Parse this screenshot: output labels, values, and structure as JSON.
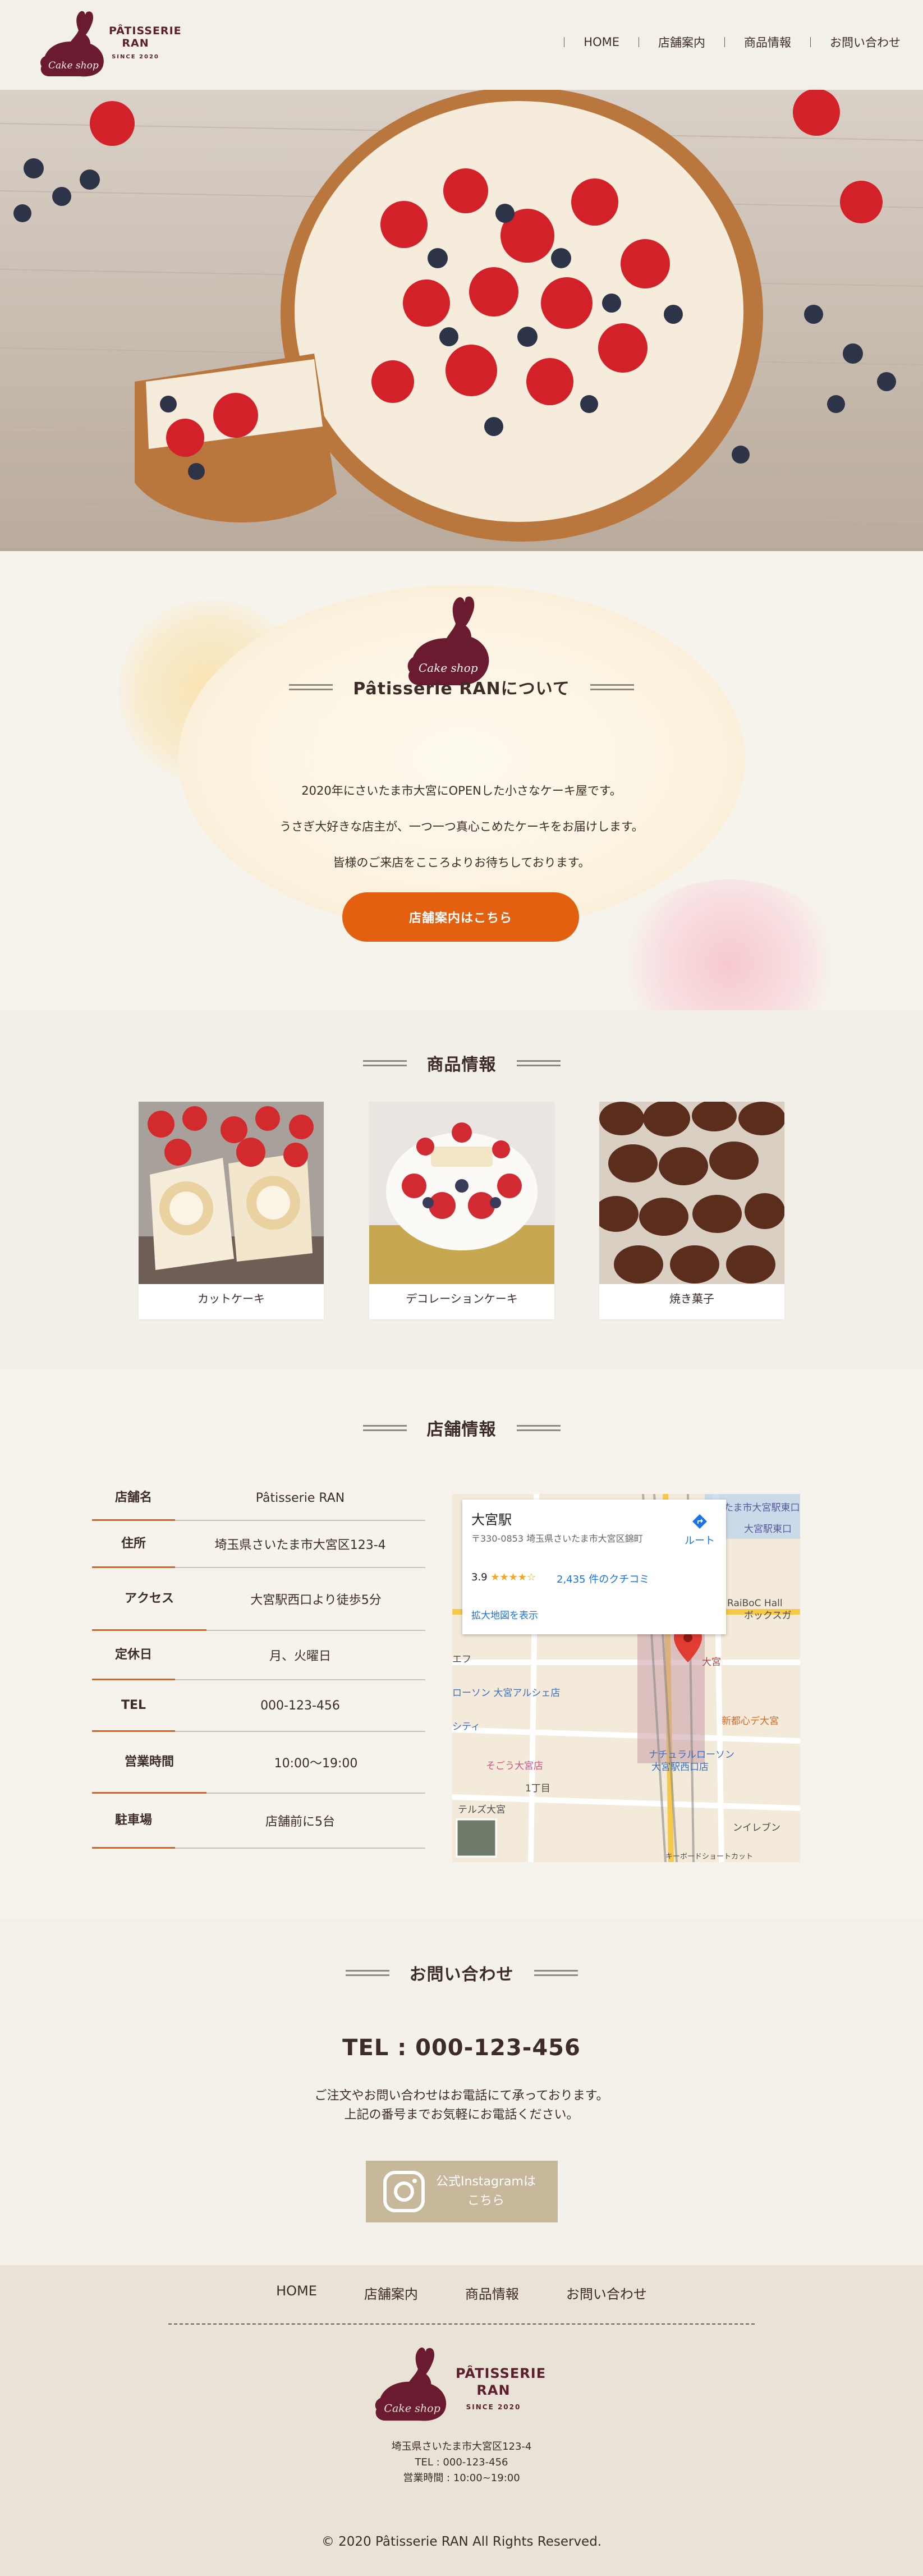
{
  "header": {
    "logo": {
      "name": "PÂTISSERIE RAN",
      "name_line1": "PÂTISSERIE",
      "name_line2": "RAN",
      "since": "SINCE 2020",
      "script": "Cake shop"
    },
    "nav": [
      "HOME",
      "店舗案内",
      "商品情報",
      "お問い合わせ"
    ]
  },
  "hero": {
    "slide_count": 2,
    "active_slide": 1
  },
  "about": {
    "heading": "Pâtisserie RANについて",
    "rabbit_script": "Cake shop",
    "lines": [
      "2020年にさいたま市大宮にOPENした小さなケーキ屋です。",
      "うさぎ大好きな店主が、一つ一つ真心こめたケーキをお届けします。",
      "皆様のご来店をこころよりお待ちしております。"
    ],
    "button": "店舗案内はこちら"
  },
  "products": {
    "heading": "商品情報",
    "items": [
      {
        "label": "カットケーキ"
      },
      {
        "label": "デコレーションケーキ"
      },
      {
        "label": "焼き菓子"
      }
    ]
  },
  "store": {
    "heading": "店舗情報",
    "rows": [
      {
        "key": "店舗名",
        "value": "Pâtisserie RAN"
      },
      {
        "key": "住所",
        "value": "埼玉県さいたま市大宮区123-4"
      },
      {
        "key": "アクセス",
        "value": "大宮駅西口より徒歩5分"
      },
      {
        "key": "定休日",
        "value": "月、火曜日"
      },
      {
        "key": "TEL",
        "value": "000-123-456"
      },
      {
        "key": "営業時間",
        "value": "10:00〜19:00"
      },
      {
        "key": "駐車場",
        "value": "店舗前に5台"
      }
    ],
    "map": {
      "place": "大宮駅",
      "address": "〒330-0853 埼玉県さいたま市大宮区錦町",
      "rating": "3.9",
      "stars": "★★★★☆",
      "reviews": "2,435 件のクチコミ",
      "large_map": "拡大地図を表示",
      "route": "ルート",
      "labels": [
        "さいたま市大宮駅東口",
        "大宮駅東口",
        "RaiBoC Hall",
        "ボックスガ",
        "ローソン 大宮アルシェ店",
        "シティ",
        "大宮",
        "そごう大宮店",
        "新都心デ大宮",
        "ナチュラルローソン",
        "大宮駅西口店",
        "1丁目",
        "テルズ大宮",
        "ンイレブン",
        "キーボードショートカット",
        "エフ"
      ]
    }
  },
  "contact": {
    "heading": "お問い合わせ",
    "tel": "TEL : 000-123-456",
    "lines": [
      "ご注文やお問い合わせはお電話にて承っております。",
      "上記の番号までお気軽にお電話ください。"
    ],
    "instagram_line1": "公式Instagramは",
    "instagram_line2": "こちら"
  },
  "footer": {
    "nav": [
      "HOME",
      "店舗案内",
      "商品情報",
      "お問い合わせ"
    ],
    "logo_line1": "PÂTISSERIE",
    "logo_line2": "RAN",
    "since": "SINCE 2020",
    "address": [
      "埼玉県さいたま市大宮区123-4",
      "TEL : 000-123-456",
      "営業時間 : 10:00~19:00"
    ],
    "copyright": "© 2020 Pâtisserie RAN All Rights Reserved."
  },
  "colors": {
    "accent": "#e2600f",
    "brand": "#5b1f2d",
    "text": "#3d2b28",
    "insta": "#c7b89b"
  }
}
